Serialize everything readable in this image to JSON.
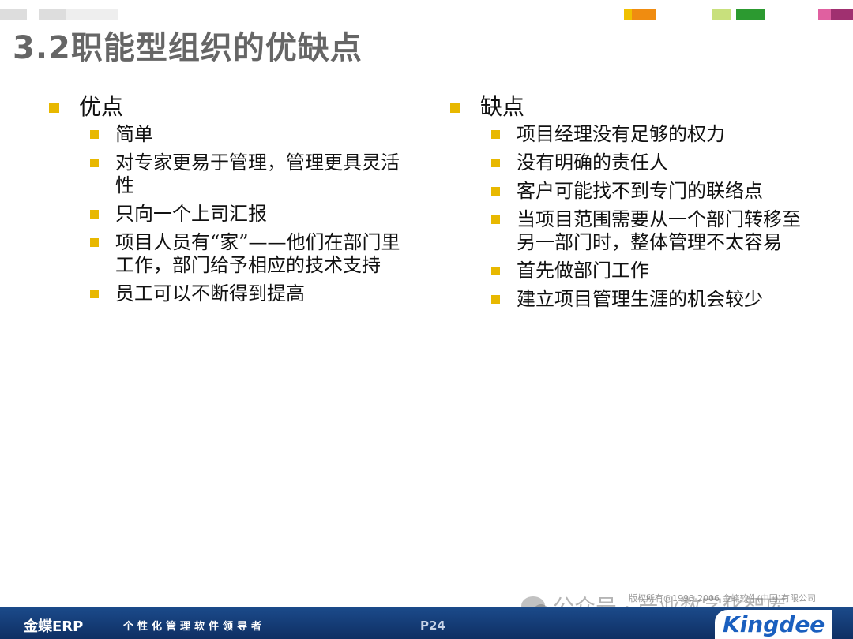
{
  "slide": {
    "title": "3.2职能型组织的优缺点",
    "page_number": "P24"
  },
  "top_bars": [
    {
      "color": "#dddddd"
    },
    {
      "color": "#dddddd"
    },
    {
      "color": "#eeeeee"
    },
    {
      "color": "#f0c000"
    },
    {
      "color": "#f08c10"
    },
    {
      "color": "#c8e07c"
    },
    {
      "color": "#2c9a30"
    },
    {
      "color": "#e060a0"
    },
    {
      "color": "#a03070"
    }
  ],
  "left": {
    "heading": "优点",
    "items": [
      "简单",
      "对专家更易于管理，管理更具灵活性",
      "只向一个上司汇报",
      "项目人员有“家”——他们在部门里工作，部门给予相应的技术支持",
      "员工可以不断得到提高"
    ]
  },
  "right": {
    "heading": "缺点",
    "items": [
      "项目经理没有足够的权力",
      "没有明确的责任人",
      "客户可能找不到专门的联络点",
      "当项目范围需要从一个部门转移至另一部门时，整体管理不太容易",
      "首先做部门工作",
      "建立项目管理生涯的机会较少"
    ]
  },
  "footer": {
    "brand": "金蝶ERP",
    "slogan": "个性化管理软件领导者",
    "copyright": "版权所有@1993-2006 金蝶软件(中国)有限公司",
    "logo": "Kingdee"
  },
  "watermark": {
    "text": "公众号 · 产业数字化智库"
  },
  "accent_color": "#e8b800"
}
